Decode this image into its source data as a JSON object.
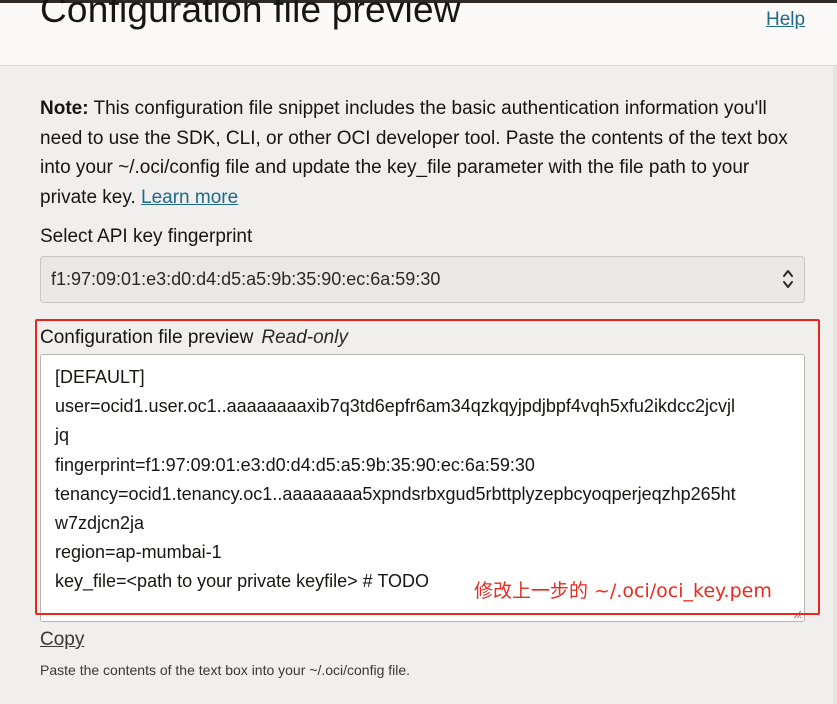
{
  "header": {
    "title": "Configuration file preview",
    "help_label": "Help"
  },
  "note": {
    "bold_label": "Note:",
    "text": " This configuration file snippet includes the basic authentication information you'll need to use the SDK, CLI, or other OCI developer tool. Paste the contents of the text box into your ~/.oci/config file and update the key_file parameter with the file path to your private key.",
    "learn_more_label": "Learn more"
  },
  "fingerprint_select": {
    "label": "Select API key fingerprint",
    "selected_value": "f1:97:09:01:e3:d0:d4:d5:a5:9b:35:90:ec:6a:59:30",
    "caret_icon": "up-down-chevron-icon"
  },
  "preview": {
    "label": "Configuration file preview",
    "readonly_label": "Read-only",
    "lines": [
      "[DEFAULT]",
      "user=ocid1.user.oc1..aaaaaaaaxib7q3td6epfr6am34qzkqyjpdjbpf4vqh5xfu2ikdcc2jcvjl",
      "jq",
      "fingerprint=f1:97:09:01:e3:d0:d4:d5:a5:9b:35:90:ec:6a:59:30",
      "tenancy=ocid1.tenancy.oc1..aaaaaaaa5xpndsrbxgud5rbttplyzepbcyoqperjeqzhp265ht",
      "w7zdjcn2ja",
      "region=ap-mumbai-1",
      "key_file=<path to your private keyfile> # TODO"
    ]
  },
  "annotation": {
    "text": "修改上一步的 ~/.oci/oci_key.pem",
    "color": "#ea2a1f"
  },
  "copy_label": "Copy",
  "help_text": "Paste the contents of the text box into your ~/.oci/config file.",
  "colors": {
    "link": "#1f6a8a",
    "background": "#f1efed",
    "annotation_red": "#e8281e"
  }
}
